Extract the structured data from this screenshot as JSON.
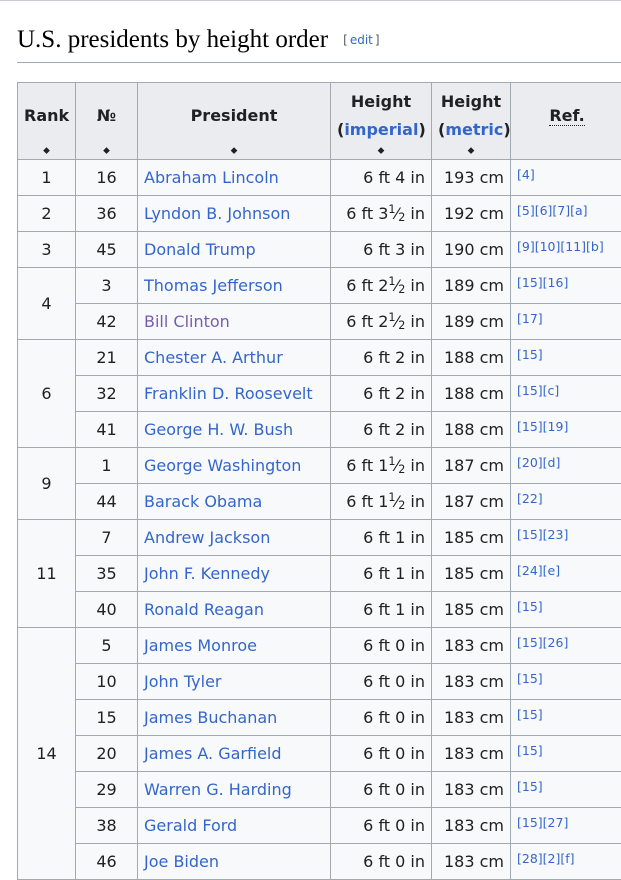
{
  "section": {
    "title": "U.S. presidents by height order",
    "edit_label": "edit",
    "bracket_open": "[",
    "bracket_close": "]"
  },
  "table": {
    "headers": {
      "rank": "Rank",
      "number": "№",
      "president": "President",
      "height_imp": "Height",
      "imperial": "imperial",
      "height_met": "Height",
      "metric": "metric",
      "ref": "Ref."
    },
    "sort_glyph": "⬥",
    "paren_open": "(",
    "paren_close": ")",
    "rank_groups": [
      {
        "rank": "1",
        "rows": 1
      },
      {
        "rank": "2",
        "rows": 1
      },
      {
        "rank": "3",
        "rows": 1
      },
      {
        "rank": "4",
        "rows": 2
      },
      {
        "rank": "6",
        "rows": 3
      },
      {
        "rank": "9",
        "rows": 2
      },
      {
        "rank": "11",
        "rows": 3
      },
      {
        "rank": "14",
        "rows": 7
      }
    ],
    "rows": [
      {
        "num": "16",
        "name": "Abraham Lincoln",
        "imp": "6 ft 4 in",
        "met": "193 cm",
        "ref": "[4]",
        "visited": false
      },
      {
        "num": "36",
        "name": "Lyndon B. Johnson",
        "imp": "6 ft 3",
        "frac": true,
        "met": "192 cm",
        "ref": "[5][6][7][a]",
        "visited": false
      },
      {
        "num": "45",
        "name": "Donald Trump",
        "imp": "6 ft 3 in",
        "met": "190 cm",
        "ref": "[9][10][11][b]",
        "visited": false
      },
      {
        "num": "3",
        "name": "Thomas Jefferson",
        "imp": "6 ft 2",
        "frac": true,
        "met": "189 cm",
        "ref": "[15][16]",
        "visited": false
      },
      {
        "num": "42",
        "name": "Bill Clinton",
        "imp": "6 ft 2",
        "frac": true,
        "met": "189 cm",
        "ref": "[17]",
        "visited": true
      },
      {
        "num": "21",
        "name": "Chester A. Arthur",
        "imp": "6 ft 2 in",
        "met": "188 cm",
        "ref": "[15]",
        "visited": false
      },
      {
        "num": "32",
        "name": "Franklin D. Roosevelt",
        "imp": "6 ft 2 in",
        "met": "188 cm",
        "ref": "[15][c]",
        "visited": false
      },
      {
        "num": "41",
        "name": "George H. W. Bush",
        "imp": "6 ft 2 in",
        "met": "188 cm",
        "ref": "[15][19]",
        "visited": false
      },
      {
        "num": "1",
        "name": "George Washington",
        "imp": "6 ft 1",
        "frac": true,
        "met": "187 cm",
        "ref": "[20][d]",
        "visited": false
      },
      {
        "num": "44",
        "name": "Barack Obama",
        "imp": "6 ft 1",
        "frac": true,
        "met": "187 cm",
        "ref": "[22]",
        "visited": false
      },
      {
        "num": "7",
        "name": "Andrew Jackson",
        "imp": "6 ft 1 in",
        "met": "185 cm",
        "ref": "[15][23]",
        "visited": false
      },
      {
        "num": "35",
        "name": "John F. Kennedy",
        "imp": "6 ft 1 in",
        "met": "185 cm",
        "ref": "[24][e]",
        "visited": false
      },
      {
        "num": "40",
        "name": "Ronald Reagan",
        "imp": "6 ft 1 in",
        "met": "185 cm",
        "ref": "[15]",
        "visited": false
      },
      {
        "num": "5",
        "name": "James Monroe",
        "imp": "6 ft 0 in",
        "met": "183 cm",
        "ref": "[15][26]",
        "visited": false
      },
      {
        "num": "10",
        "name": "John Tyler",
        "imp": "6 ft 0 in",
        "met": "183 cm",
        "ref": "[15]",
        "visited": false
      },
      {
        "num": "15",
        "name": "James Buchanan",
        "imp": "6 ft 0 in",
        "met": "183 cm",
        "ref": "[15]",
        "visited": false
      },
      {
        "num": "20",
        "name": "James A. Garfield",
        "imp": "6 ft 0 in",
        "met": "183 cm",
        "ref": "[15]",
        "visited": false
      },
      {
        "num": "29",
        "name": "Warren G. Harding",
        "imp": "6 ft 0 in",
        "met": "183 cm",
        "ref": "[15]",
        "visited": false
      },
      {
        "num": "38",
        "name": "Gerald Ford",
        "imp": "6 ft 0 in",
        "met": "183 cm",
        "ref": "[15][27]",
        "visited": false
      },
      {
        "num": "46",
        "name": "Joe Biden",
        "imp": "6 ft 0 in",
        "met": "183 cm",
        "ref": "[28][2][f]",
        "visited": false
      }
    ],
    "fraction": {
      "numerator": "1",
      "denominator": "2",
      "unit": "in"
    }
  },
  "colors": {
    "link": "#3366cc",
    "visited_link": "#795cb2",
    "header_bg": "#eaecf0",
    "cell_bg": "#f8f9fa",
    "border": "#a2a9b1"
  }
}
